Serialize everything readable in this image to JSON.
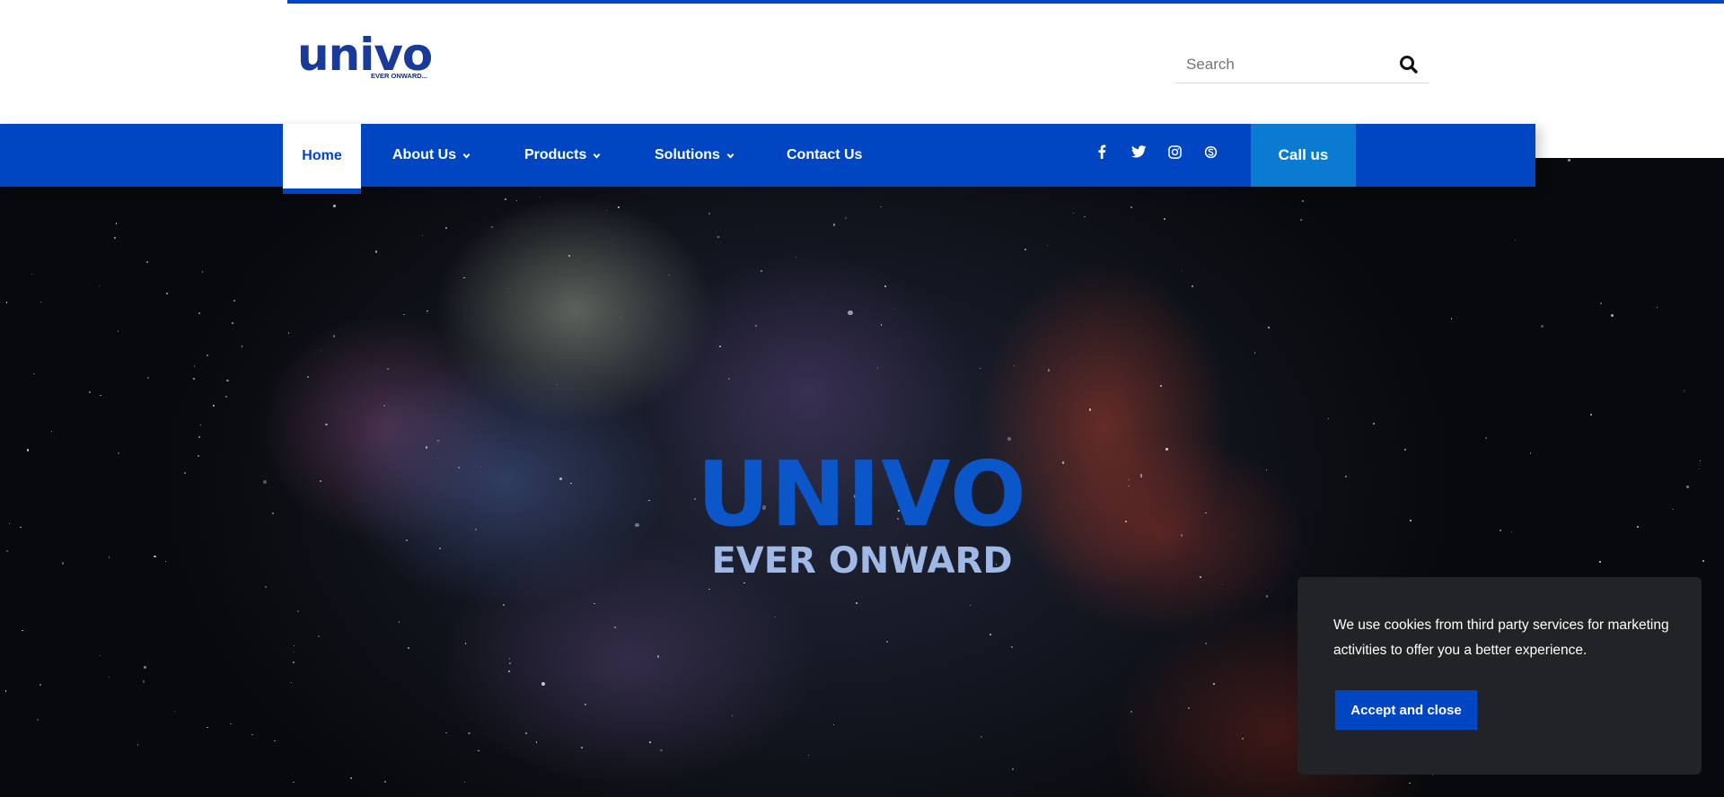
{
  "brand": {
    "logo_text": "univo",
    "logo_tagline": "EVER ONWARD...",
    "accent_color": "#0046c2",
    "call_color": "#0a7bd1"
  },
  "search": {
    "placeholder": "Search",
    "icon": "search-icon"
  },
  "nav": {
    "items": [
      {
        "label": "Home",
        "active": true
      },
      {
        "label": "About Us",
        "dropdown": true
      },
      {
        "label": "Products",
        "dropdown": true
      },
      {
        "label": "Solutions",
        "dropdown": true
      },
      {
        "label": "Contact Us"
      }
    ],
    "social": [
      "facebook-icon",
      "twitter-icon",
      "instagram-icon",
      "skype-icon"
    ],
    "call_label": "Call us"
  },
  "hero": {
    "title": "UNIVO",
    "subtitle": "EVER ONWARD"
  },
  "cookie": {
    "text": "We use cookies from third party services for marketing activities to offer you a better experience.",
    "button": "Accept and close"
  }
}
